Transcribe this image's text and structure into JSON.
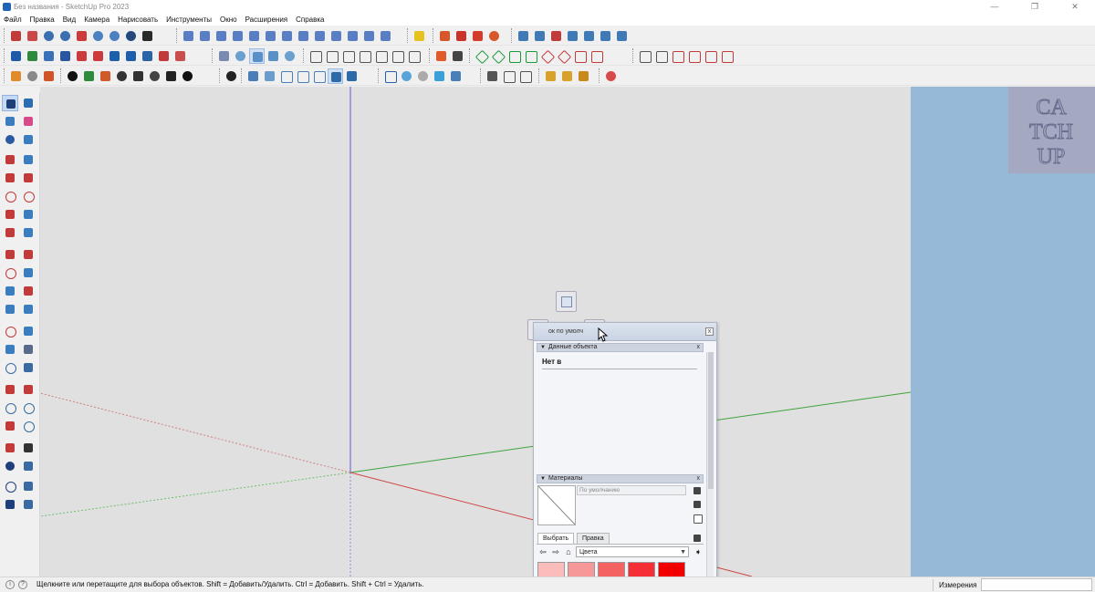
{
  "window": {
    "title": "Без названия - SketchUp Pro 2023",
    "buttons": [
      "—",
      "❐",
      "✕"
    ]
  },
  "menu": [
    "Файл",
    "Правка",
    "Вид",
    "Камера",
    "Нарисовать",
    "Инструменты",
    "Окно",
    "Расширения",
    "Справка"
  ],
  "tray": {
    "title": "ок по умолч",
    "close": "x",
    "entity_panel": {
      "label": "Данные объекта",
      "no_selection": "Нет в",
      "close": "x"
    },
    "materials_panel": {
      "label": "Материалы",
      "close": "x",
      "material_name_placeholder": "По умолчанию",
      "tabs": [
        "Выбрать",
        "Правка"
      ],
      "collection": "Цвета",
      "swatch_colors": [
        "#fbbcbc",
        "#f79898",
        "#f56262",
        "#f52f35",
        "#f20000"
      ]
    }
  },
  "statusbar": {
    "text": "Щелкните или перетащите для выбора объектов. Shift = Добавить/Удалить. Ctrl = Добавить. Shift + Ctrl = Удалить.",
    "measurements_label": "Измерения",
    "measurements_value": ""
  },
  "watermark": {
    "lines": [
      "CA",
      "TCH",
      "UP"
    ]
  },
  "colors": {
    "viewport_bg": "#e0e0e0",
    "side_panel": "#96b9d8",
    "axis_blue": "#5b5bd8",
    "axis_green": "#3ea33e",
    "axis_red": "#d04848"
  }
}
